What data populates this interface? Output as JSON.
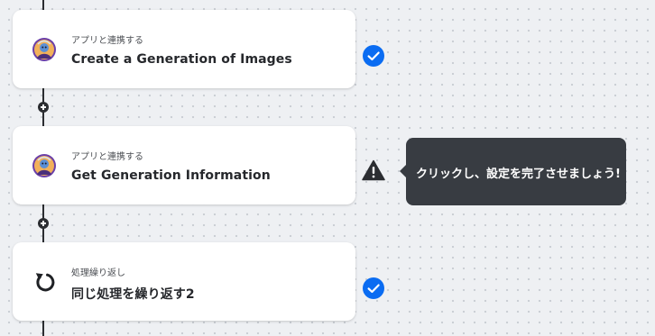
{
  "steps": [
    {
      "category": "アプリと連携する",
      "title": "Create a Generation of Images",
      "icon": "app-avatar-icon",
      "status": "complete"
    },
    {
      "category": "アプリと連携する",
      "title": "Get Generation Information",
      "icon": "app-avatar-icon",
      "status": "incomplete"
    },
    {
      "category": "処理繰り返し",
      "title": "同じ処理を繰り返す2",
      "icon": "loop-arrow-icon",
      "status": "complete"
    }
  ],
  "tooltip": {
    "text": "クリックし、設定を完了させましょう!"
  },
  "colors": {
    "check": "#0a6cf2",
    "warning": "#2b2d31",
    "tooltip_bg": "#383c42",
    "line": "#2b2d31"
  }
}
